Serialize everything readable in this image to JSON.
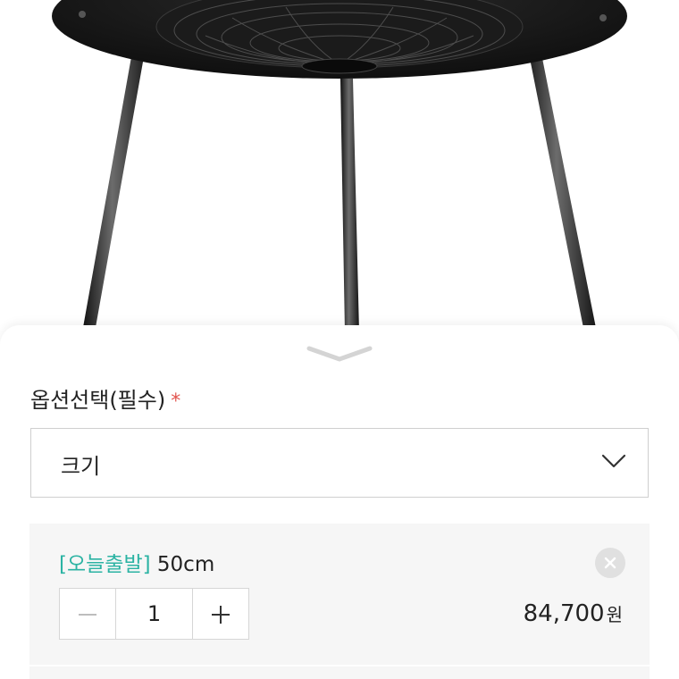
{
  "product": {
    "image_alt": "black round side table with three metal legs"
  },
  "options": {
    "title": "옵션선택(필수)",
    "required_mark": "*",
    "select": {
      "value": "크기"
    }
  },
  "selected_item": {
    "tag": "[오늘출발]",
    "name": "50cm",
    "quantity": "1",
    "price": "84,700",
    "currency": "원"
  },
  "colors": {
    "accent_tag": "#2bb3a3",
    "required": "#e2554f"
  },
  "icons": {
    "handle": "chevron-down-icon",
    "select_chevron": "chevron-down-icon",
    "remove": "close-circle-icon",
    "minus": "minus-icon",
    "plus": "plus-icon"
  }
}
